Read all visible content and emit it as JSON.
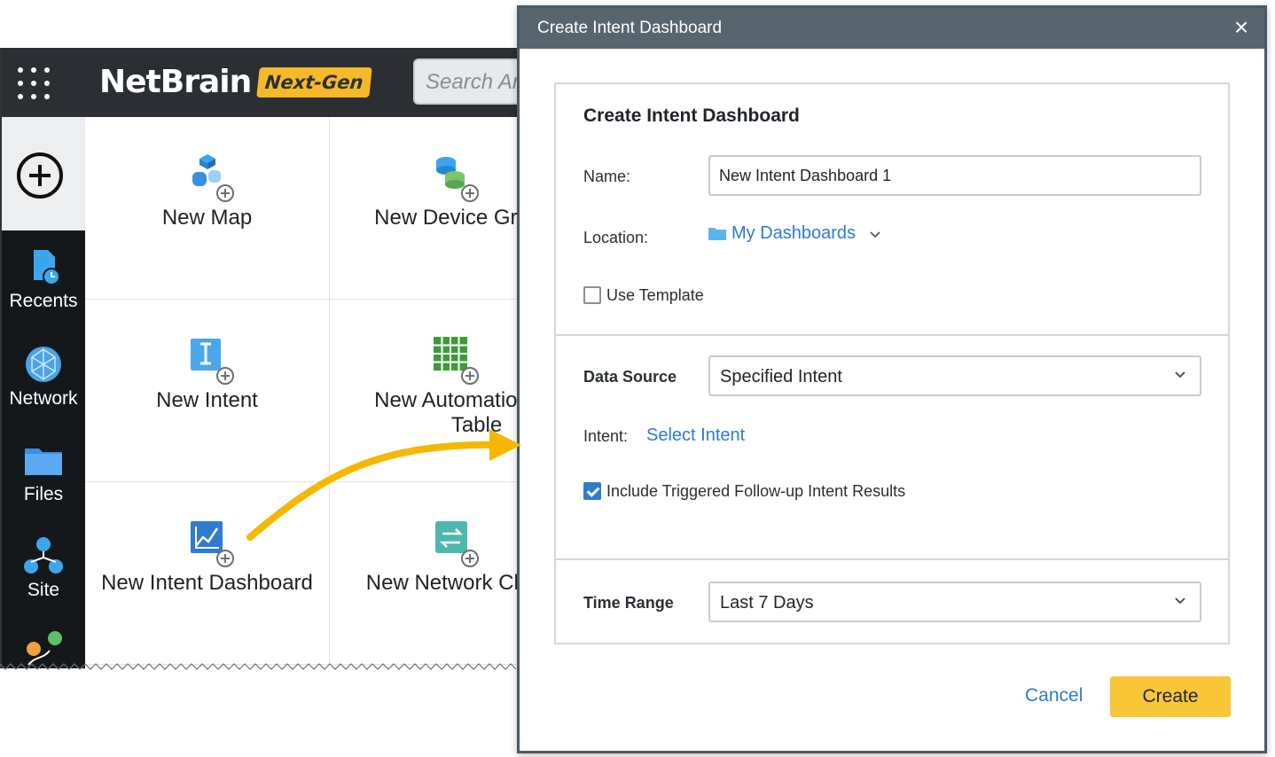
{
  "app": {
    "logo_text": "NetBrain",
    "badge": "Next-Gen",
    "search_placeholder": "Search An",
    "sidebar": [
      {
        "label": "Recents",
        "icon": "recents-icon"
      },
      {
        "label": "Network",
        "icon": "network-icon"
      },
      {
        "label": "Files",
        "icon": "folder-icon"
      },
      {
        "label": "Site",
        "icon": "site-icon"
      }
    ],
    "tiles": [
      {
        "label": "New Map",
        "icon": "new-map-icon"
      },
      {
        "label": "New Device Gro",
        "icon": "new-device-group-icon"
      },
      {
        "label": "New Intent",
        "icon": "new-intent-icon"
      },
      {
        "label": "New Automation",
        "label2": "Table",
        "icon": "new-automation-table-icon"
      },
      {
        "label": "New Intent Dashboard",
        "icon": "new-intent-dashboard-icon"
      },
      {
        "label": "New Network Cha",
        "icon": "new-network-change-icon"
      }
    ]
  },
  "modal": {
    "title": "Create Intent Dashboard",
    "close_symbol": "×",
    "panel_title": "Create Intent Dashboard",
    "name_label": "Name:",
    "name_value": "New Intent Dashboard 1",
    "location_label": "Location:",
    "location_value": "My Dashboards",
    "use_template_label": "Use Template",
    "use_template_checked": false,
    "data_source_label": "Data Source",
    "data_source_value": "Specified Intent",
    "intent_label": "Intent:",
    "intent_link": "Select Intent",
    "include_followup_label": "Include Triggered Follow-up Intent Results",
    "include_followup_checked": true,
    "time_range_label": "Time Range",
    "time_range_value": "Last 7 Days",
    "cancel_label": "Cancel",
    "create_label": "Create"
  },
  "colors": {
    "accent": "#2e7bcf",
    "create_button": "#f8c636",
    "modal_header": "#57656f",
    "arrow": "#f5b700"
  }
}
